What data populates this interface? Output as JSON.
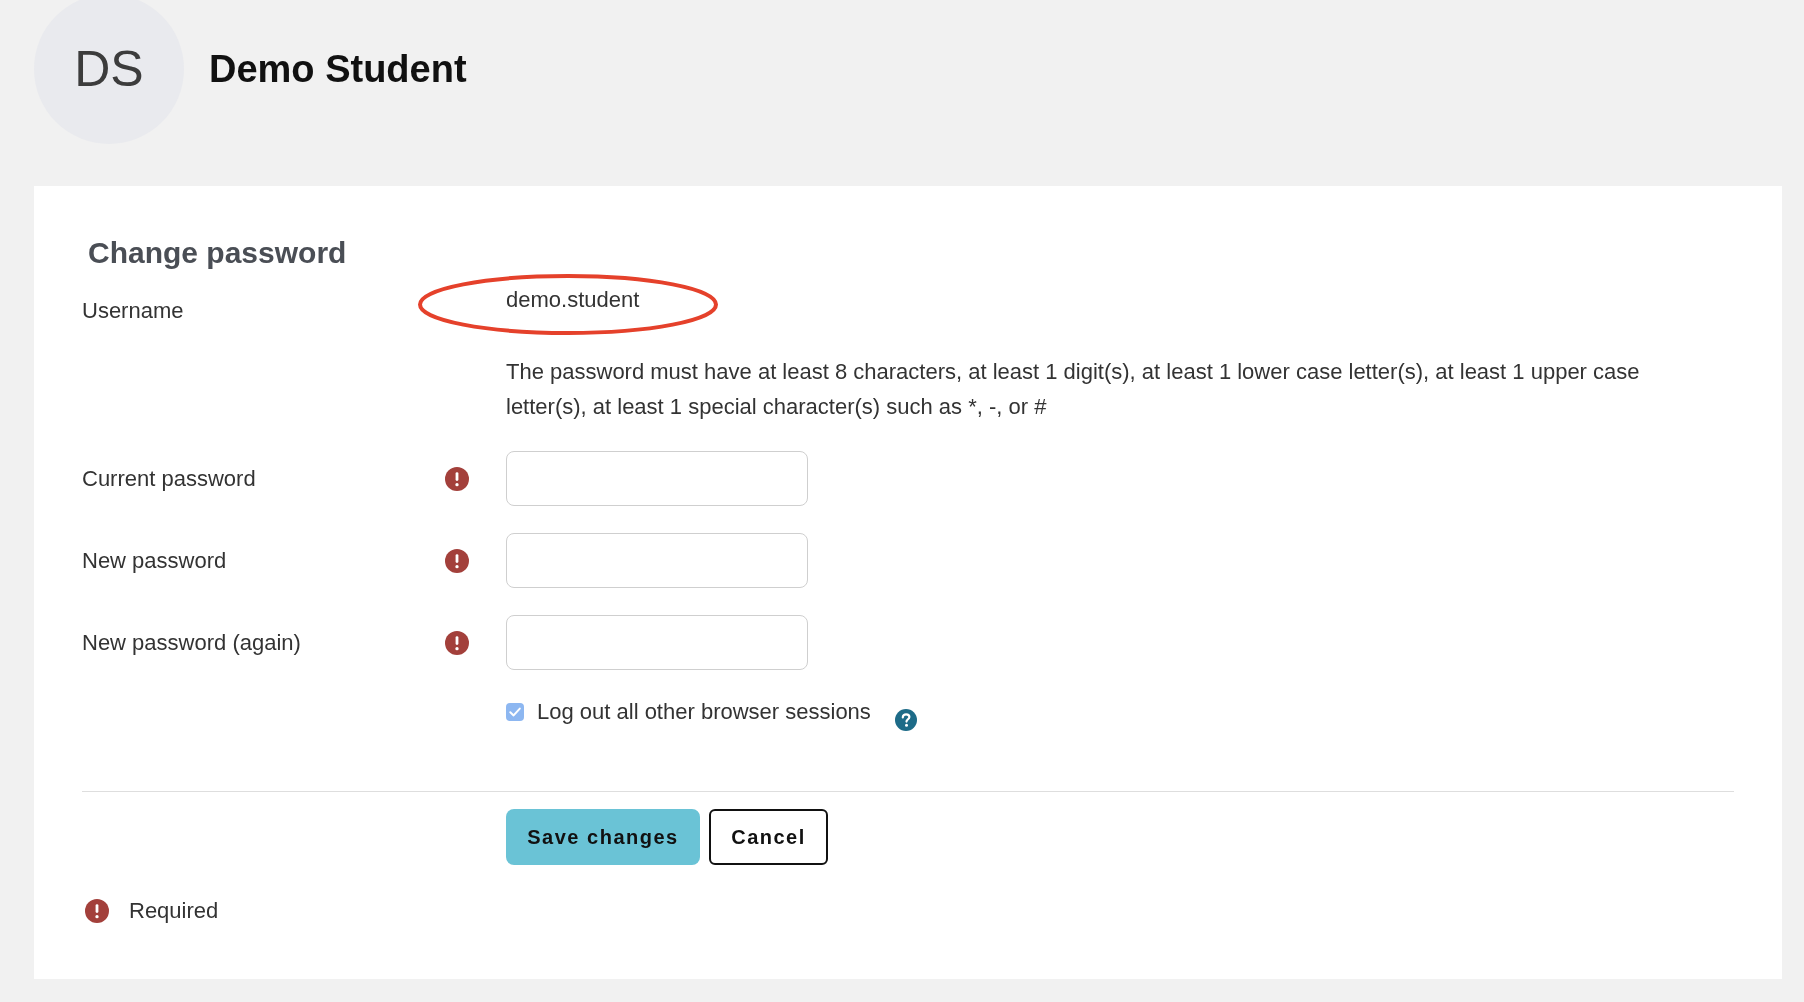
{
  "header": {
    "avatar_initials": "DS",
    "name": "Demo Student"
  },
  "form": {
    "title": "Change password",
    "username": {
      "label": "Username",
      "value": "demo.student",
      "circled": true
    },
    "password_rules": "The password must have at least 8 characters, at least 1 digit(s), at least 1 lower case letter(s), at least 1 upper case letter(s), at least 1 special character(s) such as *, -, or #",
    "fields": [
      {
        "label": "Current password",
        "required": true
      },
      {
        "label": "New password",
        "required": true
      },
      {
        "label": "New password (again)",
        "required": true
      }
    ],
    "logout_others": {
      "label": "Log out all other browser sessions",
      "checked": true
    },
    "buttons": [
      {
        "label": "Save changes",
        "kind": "primary"
      },
      {
        "label": "Cancel",
        "kind": "secondary"
      }
    ],
    "required_legend": "Required"
  }
}
